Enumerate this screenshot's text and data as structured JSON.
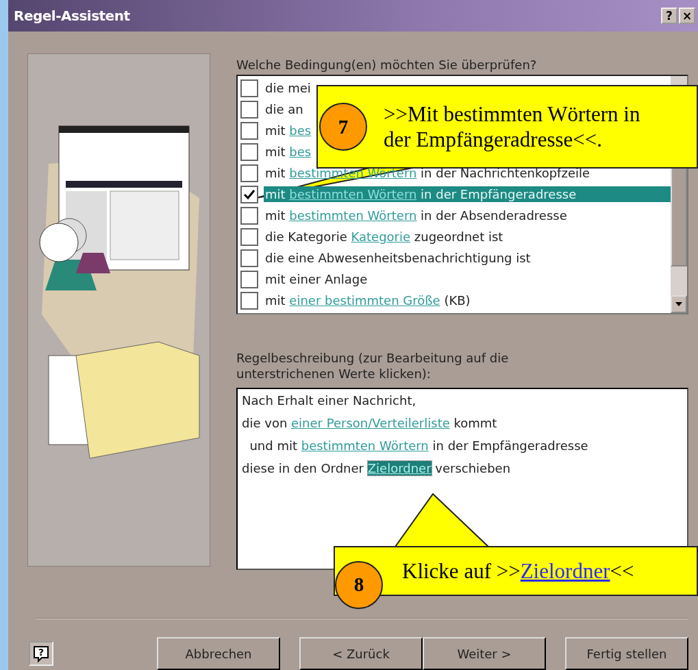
{
  "window": {
    "title": "Regel-Assistent",
    "title_buttons": [
      "?",
      "×"
    ]
  },
  "conditions": {
    "label": "Welche Bedingung(en) möchten Sie überprüfen?",
    "items": [
      {
        "checked": false,
        "selected": false,
        "segments": [
          {
            "kind": "plain",
            "text": "die mei"
          }
        ]
      },
      {
        "checked": false,
        "selected": false,
        "segments": [
          {
            "kind": "plain",
            "text": "die an"
          }
        ]
      },
      {
        "checked": false,
        "selected": false,
        "segments": [
          {
            "kind": "plain",
            "text": "mit "
          },
          {
            "kind": "link",
            "text": "bes"
          }
        ]
      },
      {
        "checked": false,
        "selected": false,
        "segments": [
          {
            "kind": "plain",
            "text": "mit "
          },
          {
            "kind": "link",
            "text": "bes"
          }
        ]
      },
      {
        "checked": false,
        "selected": false,
        "segments": [
          {
            "kind": "plain",
            "text": "mit "
          },
          {
            "kind": "link",
            "text": "bestimmten Wörtern"
          },
          {
            "kind": "plain",
            "text": " in der Nachrichtenkopfzeile"
          }
        ]
      },
      {
        "checked": true,
        "selected": true,
        "segments": [
          {
            "kind": "plain",
            "text": "mit "
          },
          {
            "kind": "link",
            "text": "bestimmten Wörtern"
          },
          {
            "kind": "plain",
            "text": " in der Empfängeradresse"
          }
        ]
      },
      {
        "checked": false,
        "selected": false,
        "segments": [
          {
            "kind": "plain",
            "text": "mit "
          },
          {
            "kind": "link",
            "text": "bestimmten Wörtern"
          },
          {
            "kind": "plain",
            "text": " in der Absenderadresse"
          }
        ]
      },
      {
        "checked": false,
        "selected": false,
        "segments": [
          {
            "kind": "plain",
            "text": "die Kategorie "
          },
          {
            "kind": "link",
            "text": "Kategorie"
          },
          {
            "kind": "plain",
            "text": " zugeordnet ist"
          }
        ]
      },
      {
        "checked": false,
        "selected": false,
        "segments": [
          {
            "kind": "plain",
            "text": "die eine Abwesenheitsbenachrichtigung ist"
          }
        ]
      },
      {
        "checked": false,
        "selected": false,
        "segments": [
          {
            "kind": "plain",
            "text": "mit einer Anlage"
          }
        ]
      },
      {
        "checked": false,
        "selected": false,
        "segments": [
          {
            "kind": "plain",
            "text": "mit "
          },
          {
            "kind": "link",
            "text": "einer bestimmten Größe"
          },
          {
            "kind": "plain",
            "text": " (KB)"
          }
        ]
      }
    ]
  },
  "description": {
    "label": "Regelbeschreibung (zur Bearbeitung auf die unterstrichenen Werte klicken):",
    "lines": [
      {
        "segments": [
          {
            "kind": "plain",
            "text": "Nach Erhalt einer Nachricht,"
          }
        ]
      },
      {
        "segments": [
          {
            "kind": "plain",
            "text": "die von "
          },
          {
            "kind": "link",
            "text": "einer Person/Verteilerliste"
          },
          {
            "kind": "plain",
            "text": " kommt"
          }
        ]
      },
      {
        "segments": [
          {
            "kind": "plain",
            "text": "  und mit "
          },
          {
            "kind": "link",
            "text": "bestimmten Wörtern"
          },
          {
            "kind": "plain",
            "text": " in der Empfängeradresse"
          }
        ]
      },
      {
        "segments": [
          {
            "kind": "plain",
            "text": "diese in den Ordner "
          },
          {
            "kind": "link-selected",
            "text": "Zielordner"
          },
          {
            "kind": "plain",
            "text": " verschieben"
          }
        ]
      }
    ]
  },
  "buttons": [
    "Abbrechen",
    "< Zurück",
    "Weiter >",
    "Fertig stellen"
  ],
  "help_button": "?",
  "callouts": [
    {
      "number": "7",
      "segments": [
        {
          "kind": "plain",
          "text": ">>Mit bestimmten Wörtern in der Empfängeradresse<<."
        }
      ]
    },
    {
      "number": "8",
      "segments": [
        {
          "kind": "plain",
          "text": "Klicke auf >>"
        },
        {
          "kind": "link",
          "text": "Zielordner"
        },
        {
          "kind": "plain",
          "text": "<<"
        }
      ]
    }
  ]
}
